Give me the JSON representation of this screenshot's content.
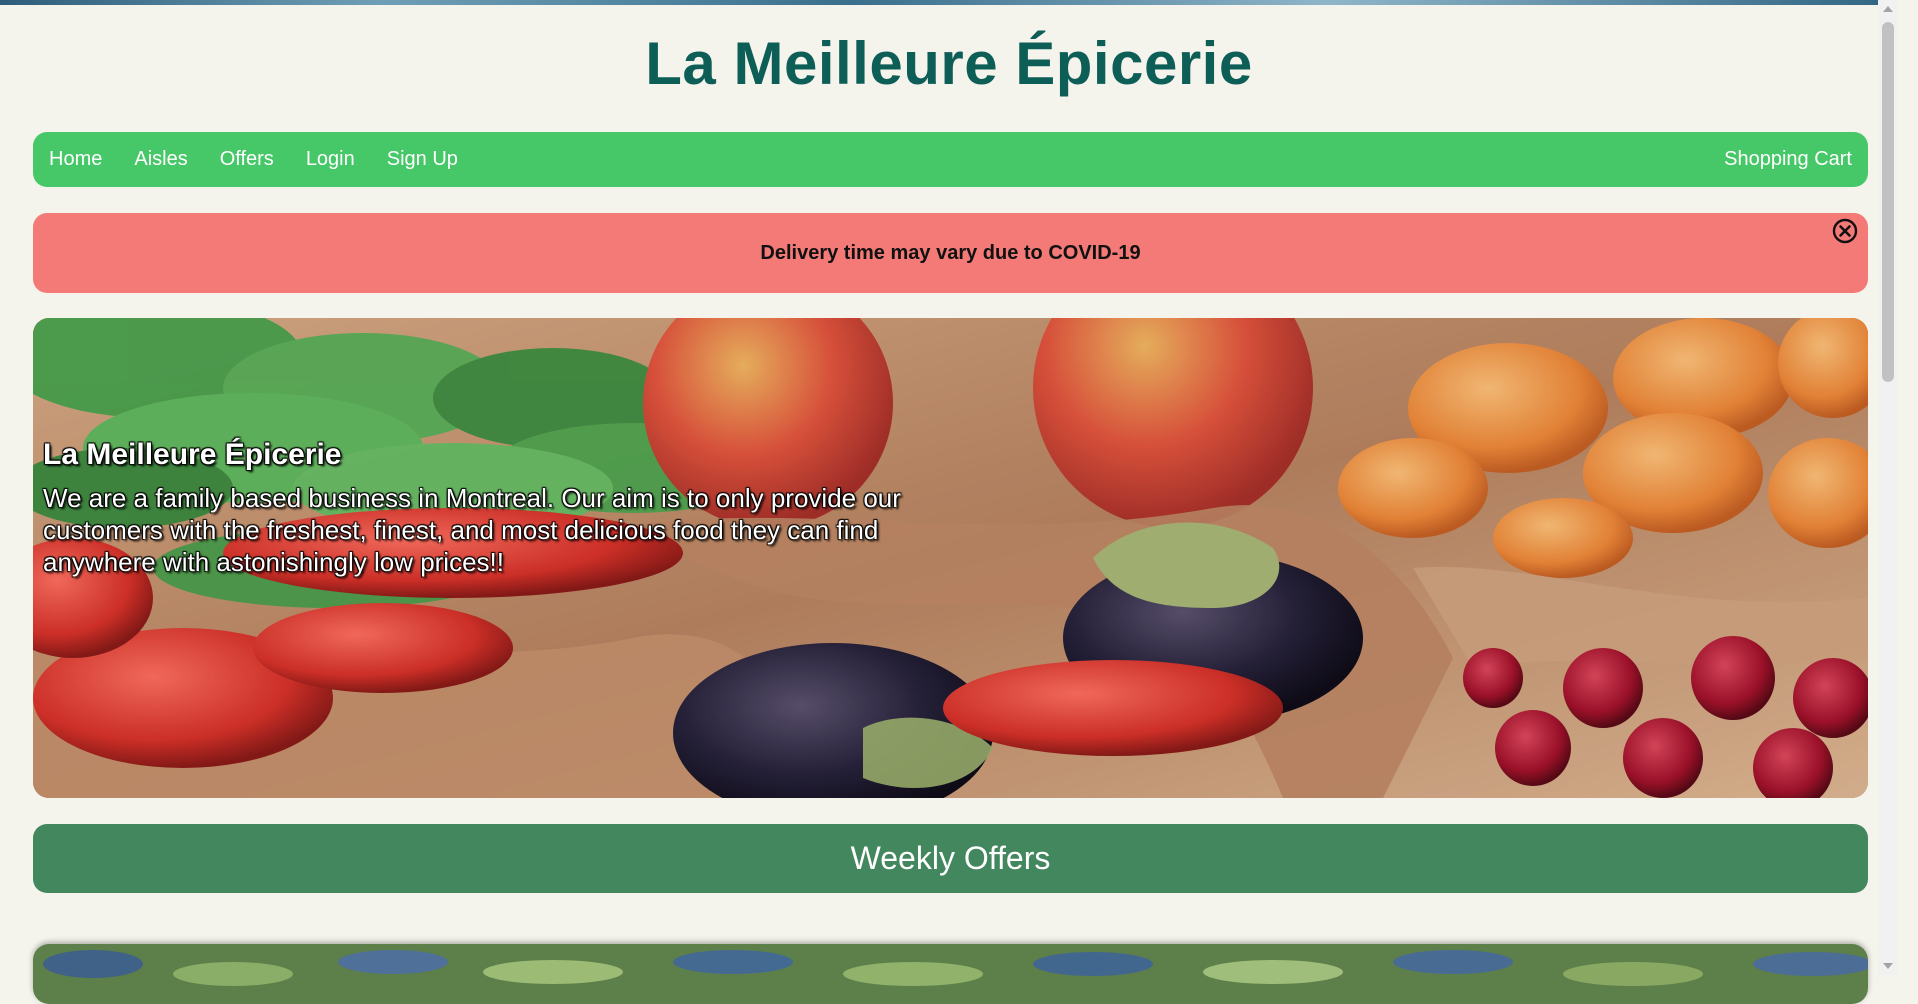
{
  "site": {
    "title": "La Meilleure Épicerie"
  },
  "nav": {
    "items": [
      {
        "label": "Home"
      },
      {
        "label": "Aisles"
      },
      {
        "label": "Offers"
      },
      {
        "label": "Login"
      },
      {
        "label": "Sign Up"
      }
    ],
    "cart_label": "Shopping Cart"
  },
  "alert": {
    "message": "Delivery time may vary due to COVID-19",
    "close_icon": "close-circle-icon"
  },
  "hero": {
    "title": "La Meilleure Épicerie",
    "description": "We are a family based business in Montreal. Our aim is to only provide our customers with the freshest, finest, and most delicious food they can find anywhere with astonishingly low prices!!"
  },
  "weekly_offers": {
    "heading": "Weekly Offers"
  },
  "colors": {
    "title": "#0e5e58",
    "nav_bg": "#46c868",
    "alert_bg": "#f47a78",
    "section_bg": "#43875e",
    "page_bg": "#f5f4ec"
  }
}
